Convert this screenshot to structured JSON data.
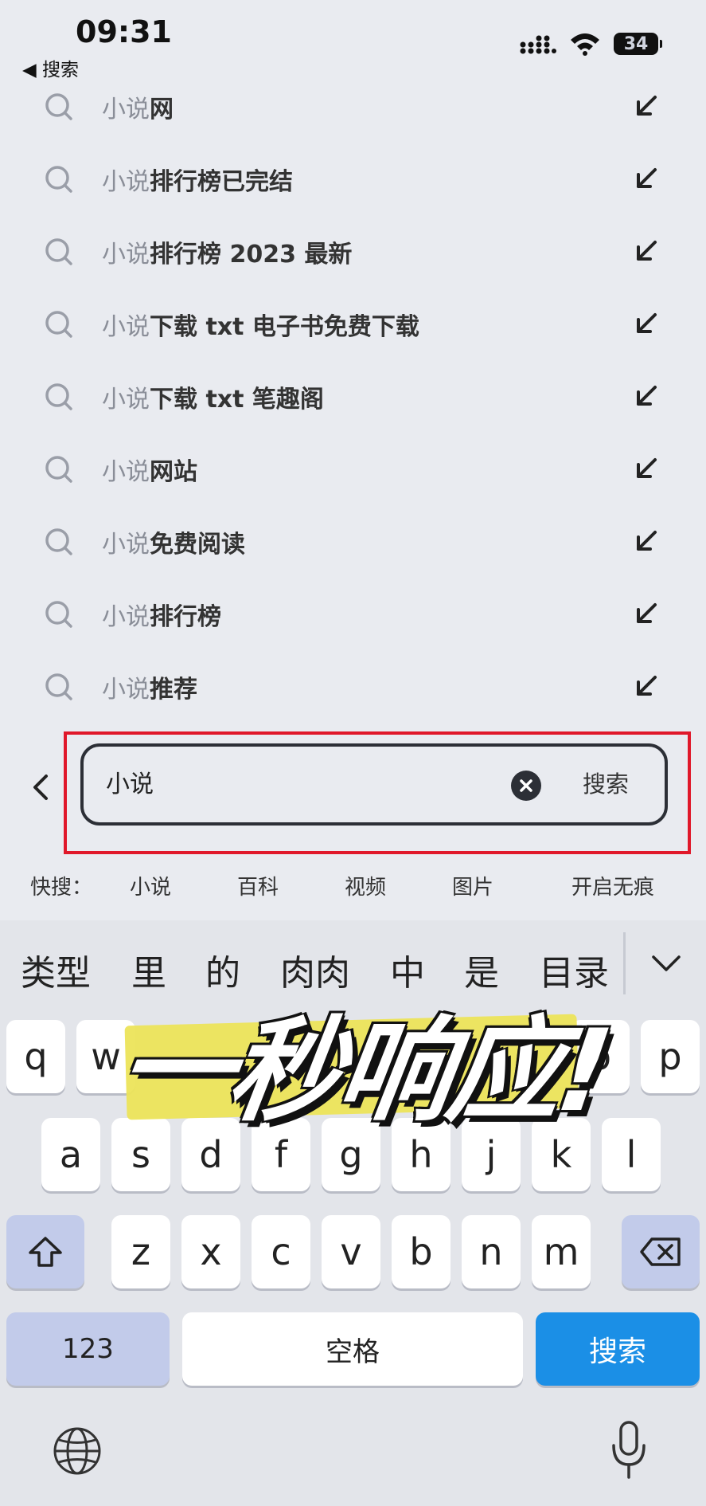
{
  "status": {
    "time": "09:31",
    "back_label": "◀ 搜索",
    "battery": "34"
  },
  "suggestions": [
    {
      "prefix": "小说",
      "rest": "网"
    },
    {
      "prefix": "小说",
      "rest": "排行榜已完结"
    },
    {
      "prefix": "小说",
      "rest": "排行榜 2023 最新"
    },
    {
      "prefix": "小说",
      "rest": "下载 txt 电子书免费下载"
    },
    {
      "prefix": "小说",
      "rest": "下载 txt 笔趣阁"
    },
    {
      "prefix": "小说",
      "rest": "网站"
    },
    {
      "prefix": "小说",
      "rest": "免费阅读"
    },
    {
      "prefix": "小说",
      "rest": "排行榜"
    },
    {
      "prefix": "小说",
      "rest": "推荐"
    }
  ],
  "search": {
    "value": "小说",
    "button": "搜索"
  },
  "quick": {
    "label": "快搜：",
    "items": [
      "小说",
      "百科",
      "视频",
      "图片",
      "开启无痕"
    ]
  },
  "keyboard": {
    "candidates": [
      "类型",
      "里",
      "的",
      "肉肉",
      "中",
      "是",
      "目录"
    ],
    "row1": [
      "q",
      "w",
      "o",
      "p"
    ],
    "row2": [
      "a",
      "s",
      "d",
      "f",
      "g",
      "h",
      "j",
      "k",
      "l"
    ],
    "row3": [
      "z",
      "x",
      "c",
      "v",
      "b",
      "n",
      "m"
    ],
    "num_key": "123",
    "space_key": "空格",
    "search_key": "搜索"
  },
  "overlay": {
    "caption": "一秒响应!"
  },
  "colors": {
    "highlight_border": "#e0182a",
    "search_key": "#1b8fe6",
    "caption_highlight": "#ece45a"
  }
}
